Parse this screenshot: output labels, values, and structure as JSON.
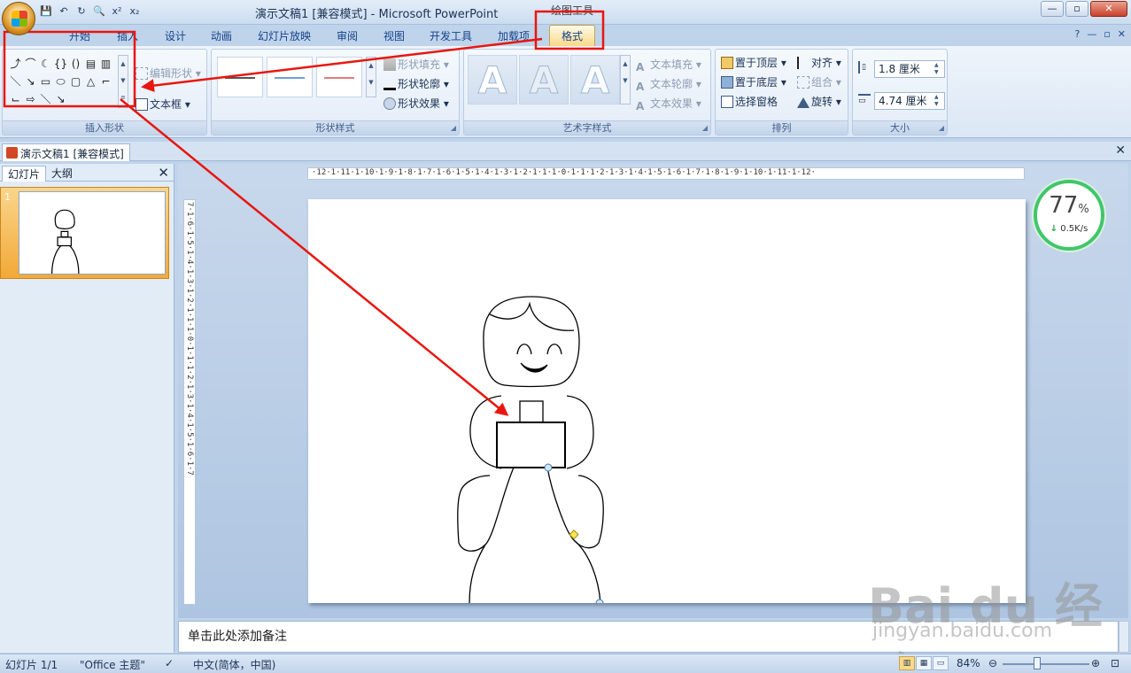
{
  "window": {
    "title": "演示文稿1 [兼容模式] - Microsoft PowerPoint",
    "context_tab_group": "绘图工具"
  },
  "qat": [
    "💾",
    "↶",
    "↻",
    "🔍",
    "x²",
    "x₂"
  ],
  "tabs": [
    {
      "label": "开始",
      "active": false
    },
    {
      "label": "插入",
      "active": false
    },
    {
      "label": "设计",
      "active": false
    },
    {
      "label": "动画",
      "active": false
    },
    {
      "label": "幻灯片放映",
      "active": false
    },
    {
      "label": "审阅",
      "active": false
    },
    {
      "label": "视图",
      "active": false
    },
    {
      "label": "开发工具",
      "active": false
    },
    {
      "label": "加载项",
      "active": false
    },
    {
      "label": "格式",
      "active": true
    }
  ],
  "ribbon": {
    "insert_shapes": {
      "label": "插入形状",
      "edit_shape": "编辑形状",
      "text_box": "文本框",
      "shapes": [
        "⤴",
        "⌒",
        "☾",
        "{}",
        "()",
        "▤",
        "▥",
        "＼",
        "↘",
        "▭",
        "⬭",
        "▢",
        "△",
        "⌐",
        "⌙",
        "⇨",
        "＼",
        "↘"
      ]
    },
    "shape_styles": {
      "label": "形状样式",
      "fill": "形状填充",
      "outline": "形状轮廓",
      "effects": "形状效果"
    },
    "wordart_styles": {
      "label": "艺术字样式",
      "glyph": "A",
      "text_fill": "文本填充",
      "text_outline": "文本轮廓",
      "text_effects": "文本效果"
    },
    "arrange": {
      "label": "排列",
      "bring_front": "置于顶层",
      "send_back": "置于底层",
      "selection_pane": "选择窗格",
      "align": "对齐",
      "group": "组合",
      "rotate": "旋转"
    },
    "size": {
      "label": "大小",
      "height": "1.8 厘米",
      "width": "4.74 厘米"
    }
  },
  "doc_tab": "演示文稿1 [兼容模式]",
  "left_pane": {
    "tab_slides": "幻灯片",
    "tab_outline": "大纲",
    "slide_number": "1"
  },
  "rulers": {
    "horizontal": "·12·1·11·1·10·1·9·1·8·1·7·1·6·1·5·1·4·1·3·1·2·1·1·1·0·1·1·1·2·1·3·1·4·1·5·1·6·1·7·1·8·1·9·1·10·1·11·1·12·",
    "vertical": "7·1·6·1·5·1·4·1·3·1·2·1·1·1·0·1·1·1·2·1·3·1·4·1·5·1·6·1·7"
  },
  "speed_widget": {
    "percent": "77",
    "percent_sign": "%",
    "rate": "0.5K/s"
  },
  "notes_placeholder": "单击此处添加备注",
  "status": {
    "slide": "幻灯片 1/1",
    "theme": "\"Office 主题\"",
    "language": "中文(简体，中国)",
    "zoom": "84%"
  },
  "watermark": {
    "main": "Bai du 经验",
    "sub": "jingyan.baidu.com"
  },
  "colors": {
    "annotation_red": "#e8160f",
    "accent_tab": "#f9d98a",
    "speed_green": "#41c66a"
  }
}
